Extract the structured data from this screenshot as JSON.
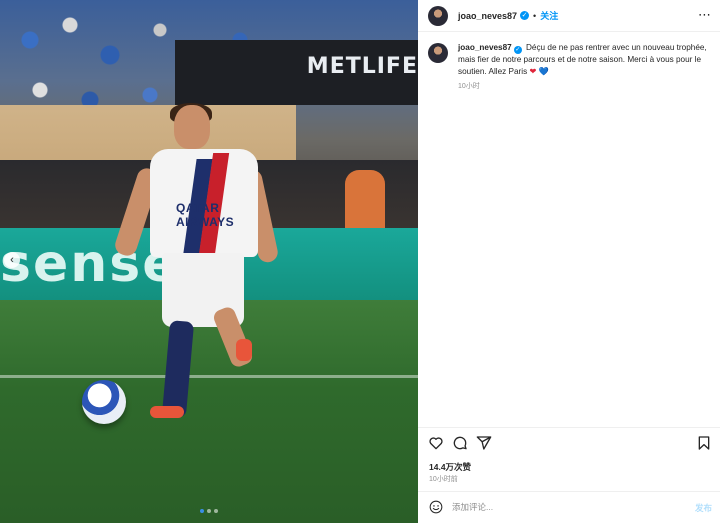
{
  "stadium": {
    "sign": "METLIFE",
    "board": "sense H",
    "sponsor": "QATAR AIRWAYS"
  },
  "carousel": {
    "prev_icon": "chevron-left-icon",
    "dots": 3,
    "active_dot": 1
  },
  "header": {
    "username": "joao_neves87",
    "verified_icon": "verified-badge-icon",
    "separator": "•",
    "follow_label": "关注",
    "more_icon": "⋯"
  },
  "caption": {
    "username": "joao_neves87",
    "text_part1": "Déçu de ne pas rentrer avec un nouveau trophée, mais fier de notre parcours et de notre saison.",
    "text_part2": "Merci à vous pour le soutien. Allez Paris",
    "heart_red": "❤",
    "heart_blue": "💙",
    "time": "10小时"
  },
  "actions": {
    "like_icon": "heart-icon",
    "comment_icon": "comment-icon",
    "share_icon": "send-icon",
    "save_icon": "bookmark-icon"
  },
  "likes": "14.4万次赞",
  "post_time": "10小时前",
  "comment": {
    "placeholder": "添加评论...",
    "post_label": "发布",
    "emoji_icon": "emoji-icon"
  },
  "colors": {
    "accent": "#0095f6",
    "text": "#262626",
    "muted": "#8e8e8e",
    "border": "#efefef"
  }
}
